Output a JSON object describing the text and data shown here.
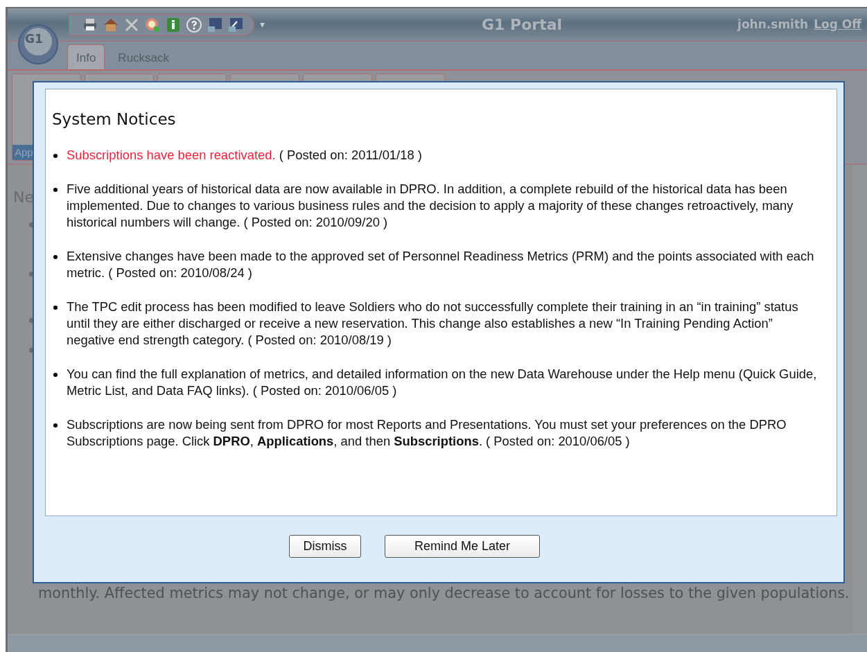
{
  "window": {
    "title": "G1 Portal"
  },
  "logo": {
    "text": "G1"
  },
  "toolbar": {
    "menu_glyph": "▾"
  },
  "user": {
    "name": "john.smith",
    "logoff": "Log Off"
  },
  "tabs": [
    {
      "label": "Info",
      "selected": true
    },
    {
      "label": "Rucksack",
      "selected": false
    }
  ],
  "ribbon": {
    "tile_label": "App"
  },
  "content": {
    "heading": "Ne",
    "footer": "monthly. Affected metrics may not change, or may only decrease to account for losses to the given populations."
  },
  "dialog": {
    "title": "System Notices",
    "notices": [
      {
        "text": "Subscriptions have been reactivated.",
        "posted": "( Posted on: 2011/01/18 )",
        "highlight": true
      },
      {
        "text": "Five additional years of historical data are now available in DPRO. In addition, a complete rebuild of the historical data has been implemented. Due to changes to various business rules and the decision to apply a majority of these changes retroactively, many historical numbers will change.",
        "posted": "( Posted on: 2010/09/20 )",
        "highlight": false
      },
      {
        "text": "Extensive changes have been made to the approved set of Personnel Readiness Metrics (PRM) and the points associated with each metric.",
        "posted": "( Posted on: 2010/08/24 )",
        "highlight": false
      },
      {
        "text": "The TPC edit process has been modified to leave Soldiers who do not successfully complete their training in an “in training” status until they are either discharged or receive a new reservation. This change also establishes a new “In Training Pending Action” negative end strength category.",
        "posted": "( Posted on: 2010/08/19 )",
        "highlight": false
      },
      {
        "text": "You can find the full explanation of metrics, and detailed information on the new Data Warehouse under the Help menu (Quick Guide, Metric List, and Data FAQ links).",
        "posted": "( Posted on: 2010/06/05 )",
        "highlight": false
      },
      {
        "text": "Subscriptions are now being sent from DPRO for most Reports and Presentations. You must set your preferences on the DPRO Subscriptions page. Click **DPRO**, **Applications**, and then **Subscriptions**.",
        "posted": "( Posted on: 2010/06/05 )",
        "highlight": false
      }
    ],
    "buttons": [
      "Dismiss",
      "Remind Me Later"
    ]
  }
}
